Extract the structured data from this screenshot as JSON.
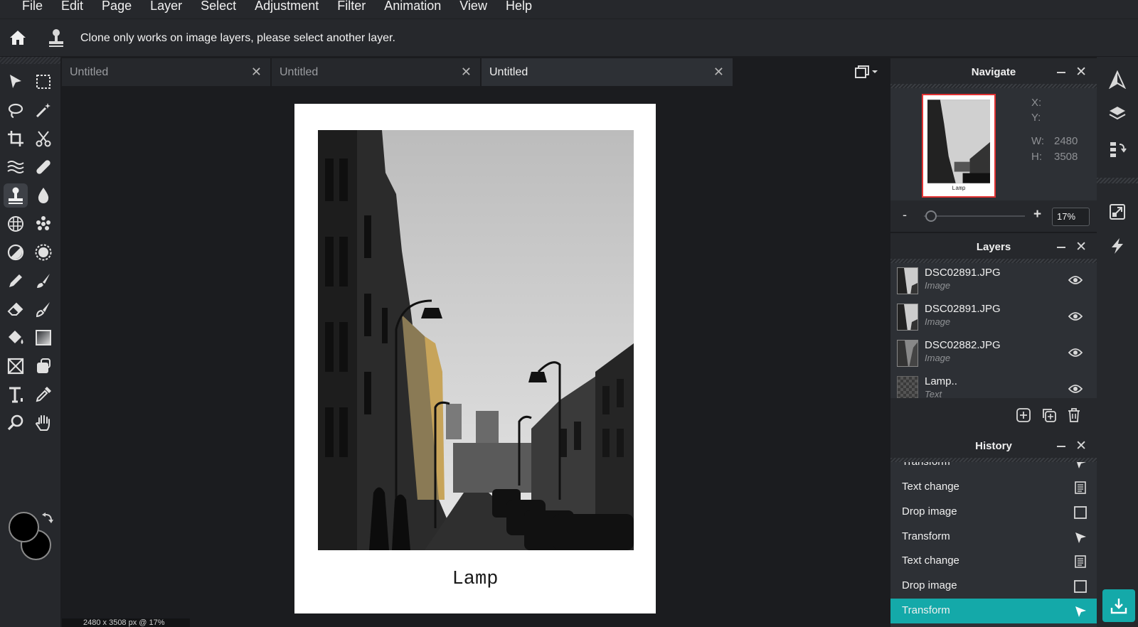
{
  "menu": [
    "File",
    "Edit",
    "Page",
    "Layer",
    "Select",
    "Adjustment",
    "Filter",
    "Animation",
    "View",
    "Help"
  ],
  "options_bar": {
    "message": "Clone only works on image layers, please select another layer."
  },
  "tools": [
    {
      "name": "move-tool-icon"
    },
    {
      "name": "marquee-tool-icon"
    },
    {
      "name": "lasso-tool-icon"
    },
    {
      "name": "magic-wand-tool-icon"
    },
    {
      "name": "crop-tool-icon"
    },
    {
      "name": "cut-tool-icon"
    },
    {
      "name": "liquify-tool-icon"
    },
    {
      "name": "healing-tool-icon"
    },
    {
      "name": "clone-stamp-tool-icon",
      "active": true
    },
    {
      "name": "blur-tool-icon"
    },
    {
      "name": "sponge-tool-icon"
    },
    {
      "name": "pattern-tool-icon"
    },
    {
      "name": "dodge-tool-icon"
    },
    {
      "name": "burn-tool-icon"
    },
    {
      "name": "pencil-tool-icon"
    },
    {
      "name": "brush-tool-icon"
    },
    {
      "name": "eraser-tool-icon"
    },
    {
      "name": "color-replace-tool-icon"
    },
    {
      "name": "paint-bucket-tool-icon"
    },
    {
      "name": "gradient-tool-icon"
    },
    {
      "name": "shape-tool-icon"
    },
    {
      "name": "sticker-tool-icon"
    },
    {
      "name": "text-tool-icon"
    },
    {
      "name": "eyedropper-tool-icon"
    },
    {
      "name": "zoom-tool-icon"
    },
    {
      "name": "hand-tool-icon"
    }
  ],
  "colors": {
    "foreground": "#000000",
    "background": "#000000",
    "accent": "#14a9a9"
  },
  "tabs": [
    {
      "label": "Untitled",
      "active": false
    },
    {
      "label": "Untitled",
      "active": false
    },
    {
      "label": "Untitled",
      "active": true
    }
  ],
  "document": {
    "caption": "Lamp",
    "status": "2480 x 3508 px @ 17%"
  },
  "navigate": {
    "title": "Navigate",
    "x_label": "X:",
    "y_label": "Y:",
    "w_label": "W:",
    "h_label": "H:",
    "width": "2480",
    "height": "3508",
    "zoom_minus": "-",
    "zoom_plus": "+",
    "zoom_value": "17%",
    "zoom_fraction": 0.0,
    "thumb_caption": "Lamp"
  },
  "layers": {
    "title": "Layers",
    "items": [
      {
        "name": "DSC02891.JPG",
        "type": "Image"
      },
      {
        "name": "DSC02891.JPG",
        "type": "Image"
      },
      {
        "name": "DSC02882.JPG",
        "type": "Image"
      },
      {
        "name": "Lamp..",
        "type": "Text"
      }
    ]
  },
  "history": {
    "title": "History",
    "items": [
      {
        "label": "Transform",
        "icon": "transform-icon"
      },
      {
        "label": "Text change",
        "icon": "text-change-icon"
      },
      {
        "label": "Drop image",
        "icon": "drop-image-icon"
      },
      {
        "label": "Transform",
        "icon": "transform-icon"
      },
      {
        "label": "Text change",
        "icon": "text-change-icon"
      },
      {
        "label": "Drop image",
        "icon": "drop-image-icon"
      },
      {
        "label": "Transform",
        "icon": "transform-icon",
        "active": true
      }
    ]
  }
}
